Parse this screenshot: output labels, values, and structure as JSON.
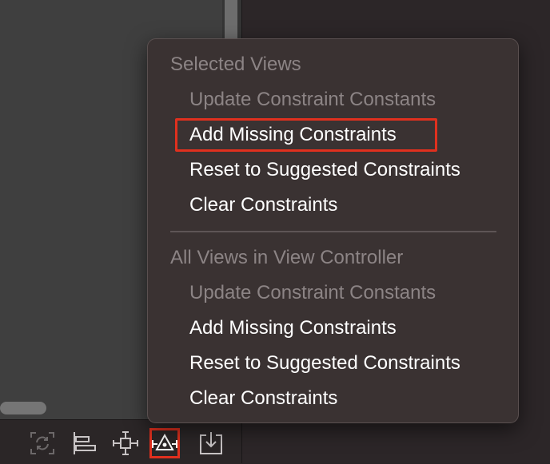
{
  "editor": {
    "toolbar": [
      {
        "name": "refresh-frames-icon"
      },
      {
        "name": "align-icon"
      },
      {
        "name": "add-new-constraints-icon"
      },
      {
        "name": "resolve-auto-layout-issues-icon"
      },
      {
        "name": "embed-in-icon"
      }
    ],
    "active_toolbar_item": "resolve-auto-layout-issues-icon"
  },
  "menu": {
    "sections": [
      {
        "header": "Selected Views",
        "items": [
          {
            "label": "Update Constraint Constants",
            "enabled": false
          },
          {
            "label": "Add Missing Constraints",
            "enabled": true,
            "highlighted": true
          },
          {
            "label": "Reset to Suggested Constraints",
            "enabled": true
          },
          {
            "label": "Clear Constraints",
            "enabled": true
          }
        ]
      },
      {
        "header": "All Views in View Controller",
        "items": [
          {
            "label": "Update Constraint Constants",
            "enabled": false
          },
          {
            "label": "Add Missing Constraints",
            "enabled": true
          },
          {
            "label": "Reset to Suggested Constraints",
            "enabled": true
          },
          {
            "label": "Clear Constraints",
            "enabled": true
          }
        ]
      }
    ]
  },
  "colors": {
    "highlight": "#e0301e",
    "menu_bg": "#3a3232",
    "disabled_text": "#8c8485"
  }
}
